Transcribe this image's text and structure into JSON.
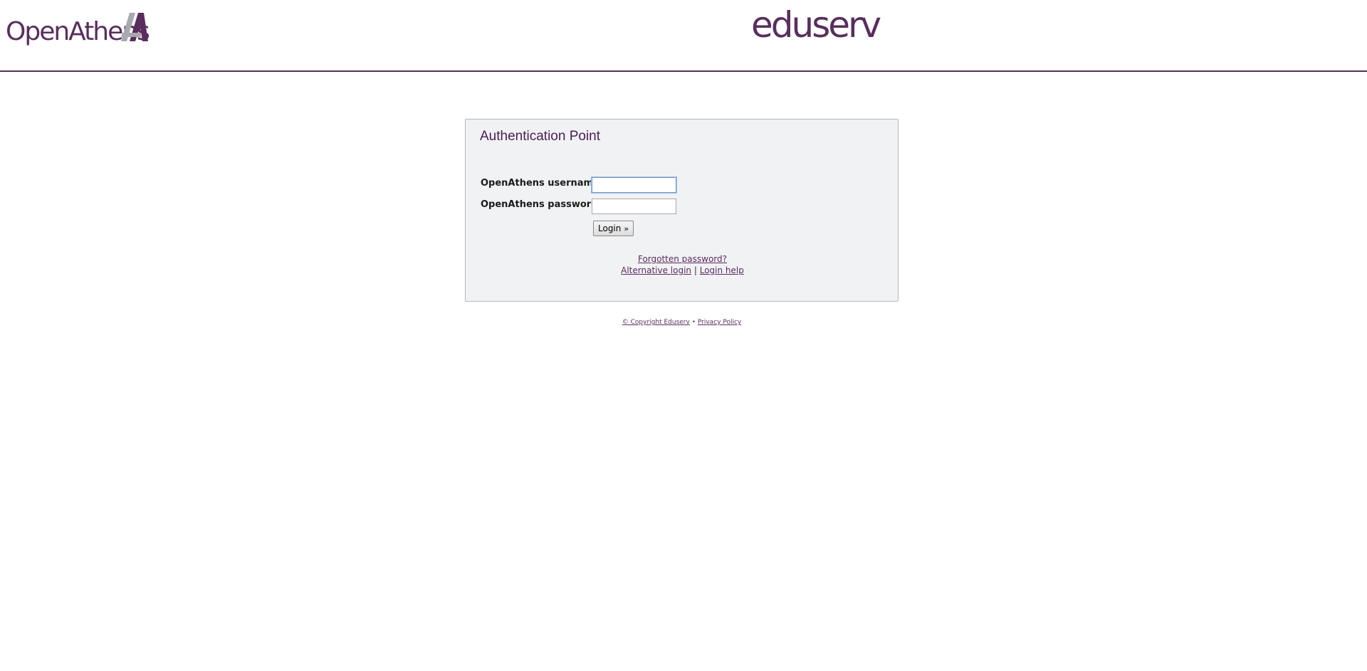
{
  "header": {
    "logo_left": "OpenAthens",
    "logo_right": "eduserv"
  },
  "colors": {
    "brand_purple": "#5a2d5e",
    "panel_bg": "#f1f2f4"
  },
  "panel": {
    "title": "Authentication Point",
    "username_label": "OpenAthens username:",
    "username_value": "",
    "password_label": "OpenAthens password:",
    "password_value": "",
    "login_label": "Login",
    "login_icon": "double-chevron-right-icon"
  },
  "links": {
    "forgotten": "Forgotten password?",
    "alternative": "Alternative login",
    "separator": "|",
    "help": "Login help"
  },
  "footer": {
    "copyright": "© Copyright Eduserv",
    "separator": "•",
    "privacy": "Privacy Policy"
  }
}
